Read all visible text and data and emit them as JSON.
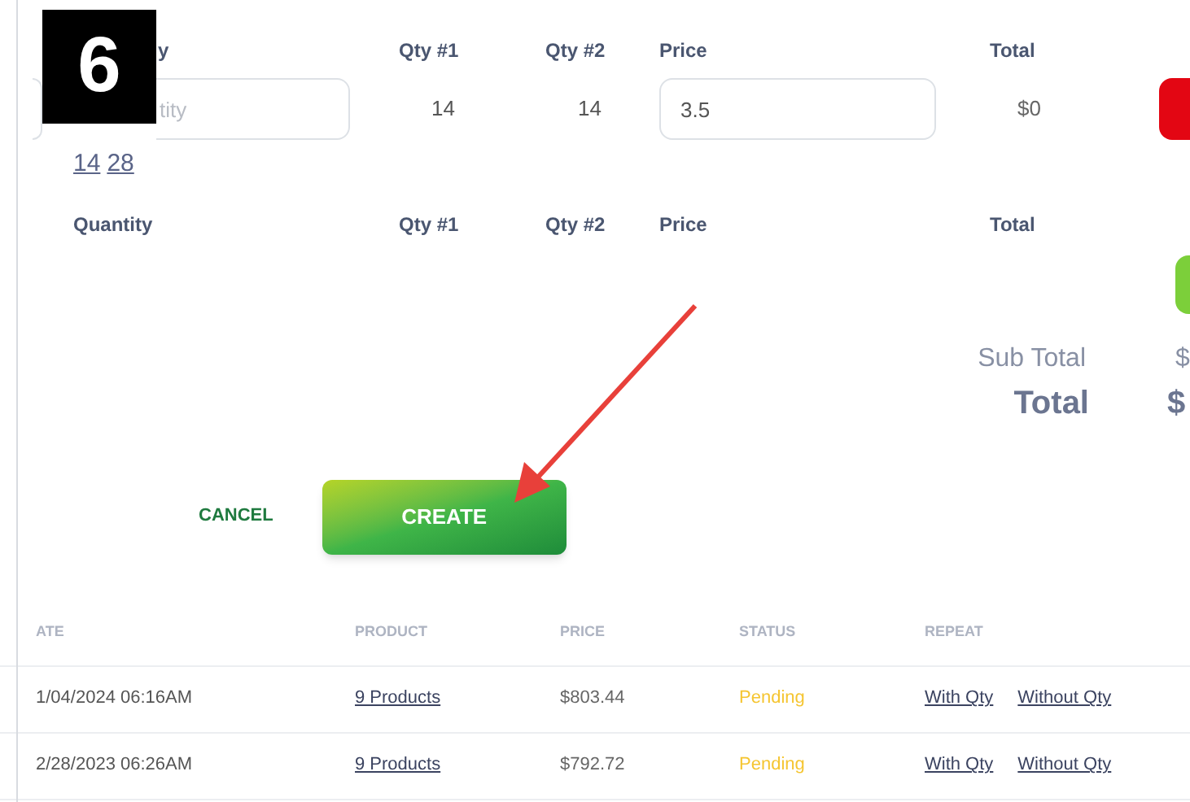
{
  "annotation": {
    "step": "6"
  },
  "item_header": {
    "quantity": "y",
    "qty1": "Qty #1",
    "qty2": "Qty #2",
    "price": "Price",
    "total": "Total"
  },
  "item_row": {
    "quantity_placeholder": "tity",
    "qty1": "14",
    "qty2": "14",
    "price": "3.5",
    "total": "$0"
  },
  "quantity_links": [
    "14",
    "28"
  ],
  "new_item_header": {
    "quantity": "Quantity",
    "qty1": "Qty #1",
    "qty2": "Qty #2",
    "price": "Price",
    "total": "Total"
  },
  "summary": {
    "subtotal_label": "Sub Total",
    "subtotal_value": "$",
    "total_label": "Total",
    "total_value": "$"
  },
  "actions": {
    "cancel": "CANCEL",
    "create": "CREATE"
  },
  "orders": {
    "columns": [
      "ATE",
      "PRODUCT",
      "PRICE",
      "STATUS",
      "REPEAT"
    ],
    "rows": [
      {
        "date": "1/04/2024 06:16AM",
        "product": "9 Products",
        "price": "$803.44",
        "status": "Pending",
        "repeat": [
          "With Qty",
          "Without Qty"
        ]
      },
      {
        "date": "2/28/2023 06:26AM",
        "product": "9 Products",
        "price": "$792.72",
        "status": "Pending",
        "repeat": [
          "With Qty",
          "Without Qty"
        ]
      }
    ]
  }
}
